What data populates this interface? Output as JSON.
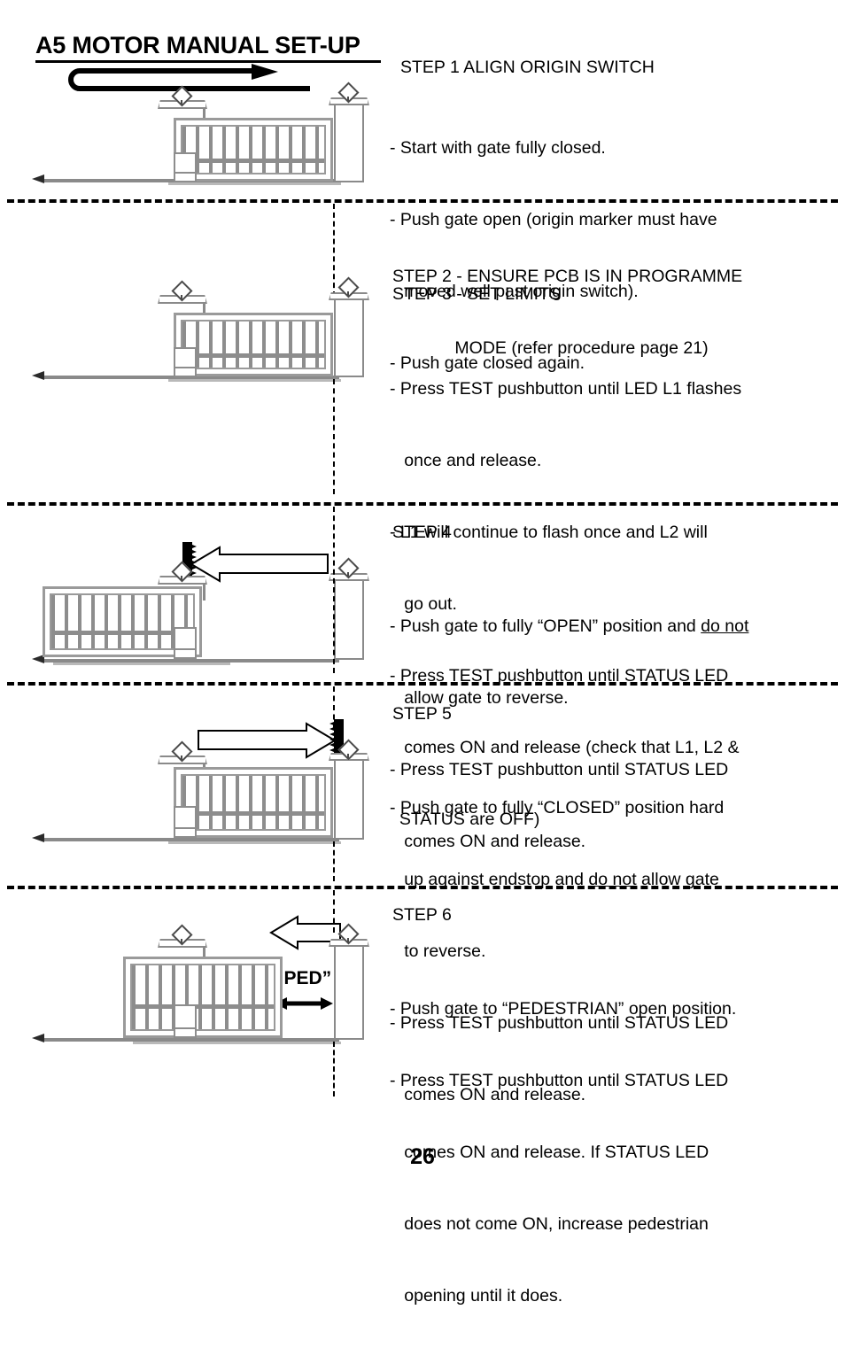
{
  "document": {
    "title": "A5 MOTOR MANUAL SET-UP",
    "page_number": "26"
  },
  "sections": [
    {
      "id": "step1",
      "heading": "STEP 1 ALIGN ORIGIN SWITCH",
      "lines": [
        "- Start with gate fully closed.",
        "- Push gate open (origin marker must have",
        "   moved well past origin switch).",
        "- Push gate closed again."
      ]
    },
    {
      "id": "step2",
      "heading": "STEP 2 - ENSURE PCB IS IN PROGRAMME",
      "heading2": "             MODE (refer procedure page 21)"
    },
    {
      "id": "step3",
      "heading": "STEP 3 - SET LIMITS",
      "lines": [
        "- Press TEST pushbutton until LED L1 flashes",
        "   once and release.",
        "- L1 will continue to flash once and L2 will",
        "   go out.",
        "- Press TEST pushbutton until STATUS LED",
        "   comes ON and release (check that L1, L2 &",
        "  STATUS are OFF)"
      ]
    },
    {
      "id": "step4",
      "heading": "STEP 4",
      "line1_a": "- Push gate to fully “OPEN” position and ",
      "line1_u": "do not",
      "lines_rest": [
        "   allow gate to reverse.",
        "- Press TEST pushbutton until STATUS LED",
        "   comes ON and release."
      ]
    },
    {
      "id": "step5",
      "heading": "STEP 5",
      "line1": "- Push gate to fully “CLOSED” position hard",
      "line2_a": "   up against endstop and ",
      "line2_u": "do not",
      "line2_b": " allow gate",
      "lines_rest": [
        "   to reverse.",
        "- Press TEST pushbutton until STATUS LED",
        "   comes ON and release."
      ]
    },
    {
      "id": "step6",
      "heading": "STEP 6",
      "lines": [
        "- Push gate to “PEDESTRIAN” open position.",
        "- Press TEST pushbutton until STATUS LED",
        "   comes ON and release. If STATUS LED",
        "   does not come ON, increase pedestrian",
        "   opening until it does."
      ]
    }
  ],
  "diagrams": {
    "ped_label": "“PED”"
  },
  "colors": {
    "ink": "#000000",
    "line_gray": "#8a8a8a",
    "gate_gray": "#9a9a9a",
    "bar_gray": "#8d8d8d",
    "paper": "#ffffff"
  }
}
